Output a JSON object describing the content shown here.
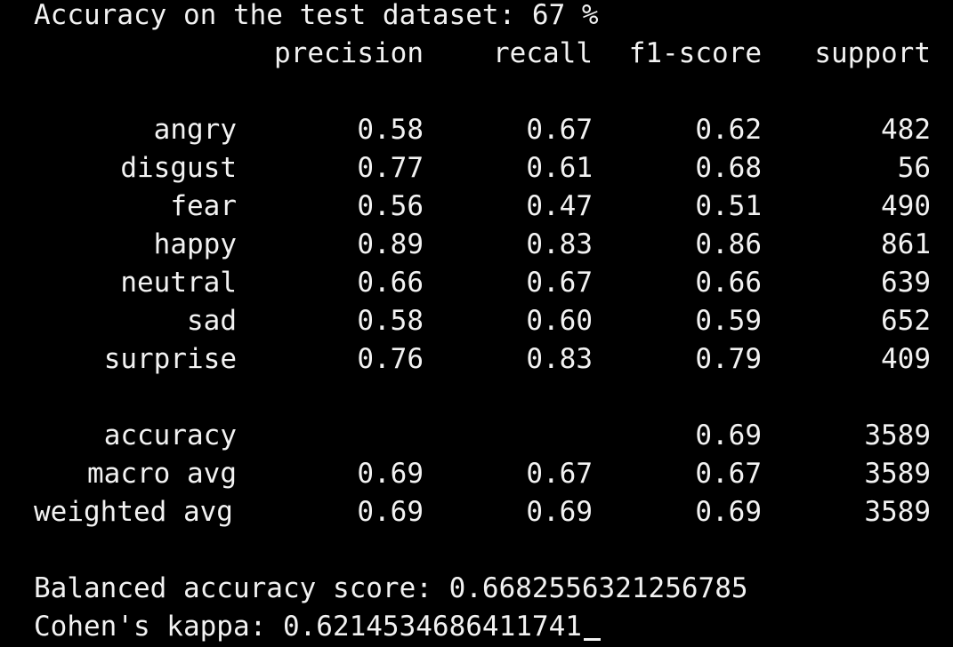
{
  "header_line": "Accuracy on the test dataset: 67 %",
  "columns": {
    "precision": "precision",
    "recall": "recall",
    "f1": "f1-score",
    "support": "support"
  },
  "rows": [
    {
      "label": "angry",
      "precision": "0.58",
      "recall": "0.67",
      "f1": "0.62",
      "support": "482"
    },
    {
      "label": "disgust",
      "precision": "0.77",
      "recall": "0.61",
      "f1": "0.68",
      "support": "56"
    },
    {
      "label": "fear",
      "precision": "0.56",
      "recall": "0.47",
      "f1": "0.51",
      "support": "490"
    },
    {
      "label": "happy",
      "precision": "0.89",
      "recall": "0.83",
      "f1": "0.86",
      "support": "861"
    },
    {
      "label": "neutral",
      "precision": "0.66",
      "recall": "0.67",
      "f1": "0.66",
      "support": "639"
    },
    {
      "label": "sad",
      "precision": "0.58",
      "recall": "0.60",
      "f1": "0.59",
      "support": "652"
    },
    {
      "label": "surprise",
      "precision": "0.76",
      "recall": "0.83",
      "f1": "0.79",
      "support": "409"
    }
  ],
  "summary": [
    {
      "label": "accuracy",
      "precision": "",
      "recall": "",
      "f1": "0.69",
      "support": "3589"
    },
    {
      "label": "macro avg",
      "precision": "0.69",
      "recall": "0.67",
      "f1": "0.67",
      "support": "3589"
    },
    {
      "label": "weighted avg",
      "precision": "0.69",
      "recall": "0.69",
      "f1": "0.69",
      "support": "3589"
    }
  ],
  "balanced_line": "Balanced accuracy score: 0.6682556321256785",
  "kappa_line": "Cohen's kappa: 0.6214534686411741"
}
